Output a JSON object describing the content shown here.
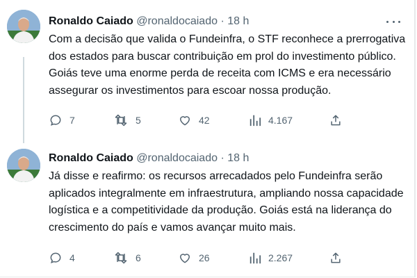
{
  "tweets": [
    {
      "name": "Ronaldo Caiado",
      "handle": "@ronaldocaiado",
      "separator": "·",
      "time": "18 h",
      "text_lines": [
        "Com a decisão que valida o Fundeinfra, o STF reconhece a prerrogativa",
        "dos estados para buscar contribuição em prol do investimento público.",
        "Goiás teve uma enorme perda de receita com ICMS e era necessário",
        "assegurar os investimentos para escoar nossa produção."
      ],
      "replies": "7",
      "retweets": "5",
      "likes": "42",
      "views": "4.167"
    },
    {
      "name": "Ronaldo Caiado",
      "handle": "@ronaldocaiado",
      "separator": "·",
      "time": "18 h",
      "text_lines": [
        "Já disse e reafirmo: os recursos arrecadados pelo Fundeinfra serão",
        "aplicados integralmente em infraestrutura, ampliando nossa capacidade",
        "logística e a competitividade da produção. Goiás está na liderança do",
        "crescimento do país e vamos avançar muito mais."
      ],
      "replies": "4",
      "retweets": "6",
      "likes": "26",
      "views": "2.267"
    }
  ],
  "colors": {
    "text": "#0f1419",
    "secondary": "#536471",
    "thread_line": "#cfd9de",
    "avatar_bg": "#7da3c9"
  },
  "icons": [
    "more-options-icon",
    "reply-icon",
    "retweet-icon",
    "like-icon",
    "views-icon",
    "share-icon"
  ]
}
